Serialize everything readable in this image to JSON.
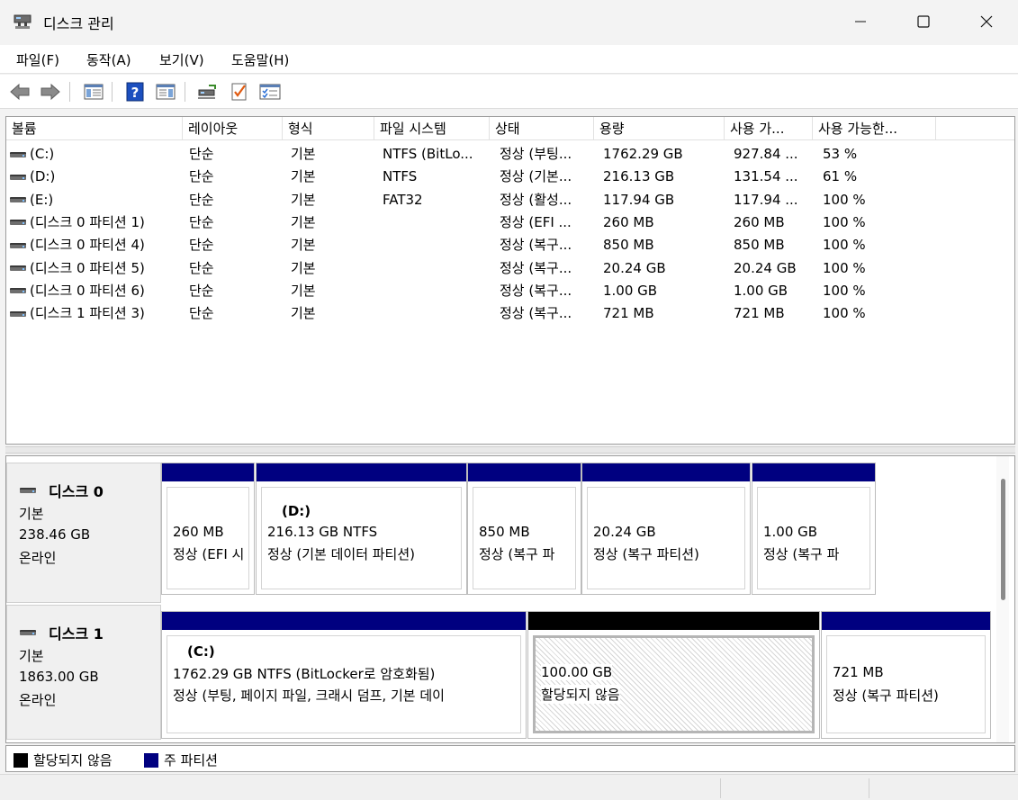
{
  "window": {
    "title": "디스크 관리",
    "minimize": "—",
    "maximize": "☐",
    "close": "✕"
  },
  "menu": [
    "파일(F)",
    "동작(A)",
    "보기(V)",
    "도움말(H)"
  ],
  "toolbar": [
    "back",
    "forward",
    "console-tree",
    "help",
    "properties-view",
    "connect-drive",
    "checklist",
    "list-view"
  ],
  "list": {
    "columns": [
      "볼륨",
      "레이아웃",
      "형식",
      "파일 시스템",
      "상태",
      "용량",
      "사용 가...",
      "사용 가능한..."
    ],
    "rows": [
      [
        "(C:)",
        "단순",
        "기본",
        "NTFS (BitLo...",
        "정상 (부팅...",
        "1762.29 GB",
        "927.84 ...",
        "53 %"
      ],
      [
        "(D:)",
        "단순",
        "기본",
        "NTFS",
        "정상 (기본...",
        "216.13 GB",
        "131.54 ...",
        "61 %"
      ],
      [
        "(E:)",
        "단순",
        "기본",
        "FAT32",
        "정상 (활성...",
        "117.94 GB",
        "117.94 ...",
        "100 %"
      ],
      [
        "(디스크 0 파티션 1)",
        "단순",
        "기본",
        "",
        "정상 (EFI ...",
        "260 MB",
        "260 MB",
        "100 %"
      ],
      [
        "(디스크 0 파티션 4)",
        "단순",
        "기본",
        "",
        "정상 (복구...",
        "850 MB",
        "850 MB",
        "100 %"
      ],
      [
        "(디스크 0 파티션 5)",
        "단순",
        "기본",
        "",
        "정상 (복구...",
        "20.24 GB",
        "20.24 GB",
        "100 %"
      ],
      [
        "(디스크 0 파티션 6)",
        "단순",
        "기본",
        "",
        "정상 (복구...",
        "1.00 GB",
        "1.00 GB",
        "100 %"
      ],
      [
        "(디스크 1 파티션 3)",
        "단순",
        "기본",
        "",
        "정상 (복구...",
        "721 MB",
        "721 MB",
        "100 %"
      ]
    ]
  },
  "disks": [
    {
      "name": "디스크 0",
      "type": "기본",
      "size": "238.46 GB",
      "status": "온라인",
      "partitions": [
        {
          "label": "",
          "line1": "260 MB",
          "line2": "정상 (EFI 시",
          "bar": "#000080"
        },
        {
          "label": "(D:)",
          "line1": "216.13 GB NTFS",
          "line2": "정상 (기본 데이터 파티션)",
          "bar": "#000080"
        },
        {
          "label": "",
          "line1": "850 MB",
          "line2": "정상 (복구 파",
          "bar": "#000080"
        },
        {
          "label": "",
          "line1": "20.24 GB",
          "line2": "정상 (복구 파티션)",
          "bar": "#000080"
        },
        {
          "label": "",
          "line1": "1.00 GB",
          "line2": "정상 (복구 파",
          "bar": "#000080"
        }
      ]
    },
    {
      "name": "디스크 1",
      "type": "기본",
      "size": "1863.00 GB",
      "status": "온라인",
      "partitions": [
        {
          "label": "(C:)",
          "line1": "1762.29 GB NTFS (BitLocker로 암호화됨)",
          "line2": "정상 (부팅, 페이지 파일, 크래시 덤프, 기본 데이",
          "bar": "#000080"
        },
        {
          "label": "",
          "line1": "100.00 GB",
          "line2": "할당되지 않음",
          "bar": "#000000"
        },
        {
          "label": "",
          "line1": "721 MB",
          "line2": "정상 (복구 파티션)",
          "bar": "#000080"
        }
      ]
    }
  ],
  "legend": [
    {
      "label": "할당되지 않음",
      "color": "#000000"
    },
    {
      "label": "주 파티션",
      "color": "#000080"
    }
  ]
}
